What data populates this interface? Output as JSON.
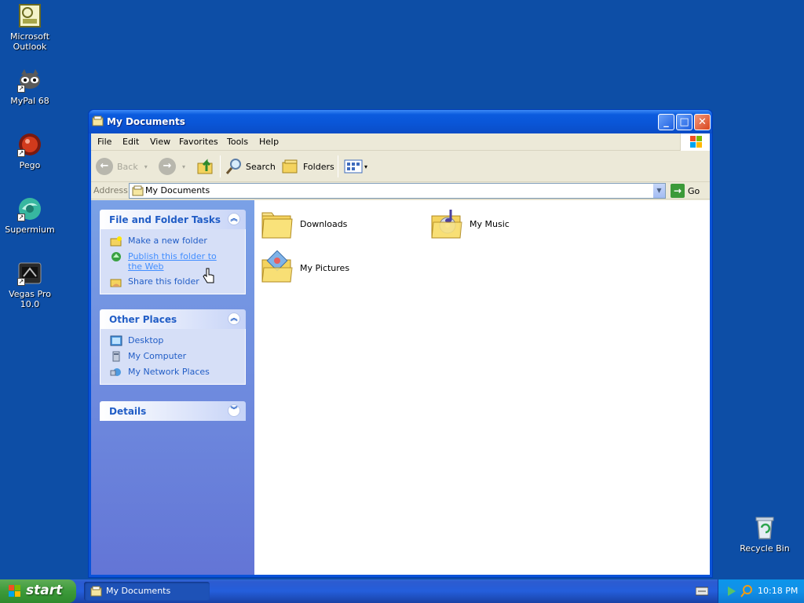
{
  "desktop": {
    "icons": [
      {
        "label": "Microsoft Outlook",
        "icon": "outlook-icon"
      },
      {
        "label": "MyPal 68",
        "icon": "raccoon-icon"
      },
      {
        "label": "Pego",
        "icon": "pego-icon"
      },
      {
        "label": "Supermium",
        "icon": "supermium-icon"
      },
      {
        "label": "Vegas Pro 10.0",
        "icon": "vegas-icon"
      },
      {
        "label": "Recycle Bin",
        "icon": "recycle-bin-icon"
      }
    ]
  },
  "window": {
    "title": "My Documents",
    "menu": [
      "File",
      "Edit",
      "View",
      "Favorites",
      "Tools",
      "Help"
    ],
    "toolbar": {
      "back": "Back",
      "search": "Search",
      "folders": "Folders"
    },
    "address": {
      "label": "Address",
      "value": "My Documents",
      "go": "Go"
    },
    "taskpane": {
      "file_tasks": {
        "title": "File and Folder Tasks",
        "items": [
          "Make a new folder",
          "Publish this folder to the Web",
          "Share this folder"
        ]
      },
      "other_places": {
        "title": "Other Places",
        "items": [
          "Desktop",
          "My Computer",
          "My Network Places"
        ]
      },
      "details": {
        "title": "Details"
      }
    },
    "items": [
      {
        "label": "Downloads",
        "icon": "folder-icon"
      },
      {
        "label": "My Music",
        "icon": "music-folder-icon"
      },
      {
        "label": "My Pictures",
        "icon": "pictures-folder-icon"
      }
    ]
  },
  "taskbar": {
    "start": "start",
    "task": "My Documents",
    "clock": "10:18 PM"
  },
  "colors": {
    "desktop": "#0d4ea6",
    "titlebar": "#0a55d6",
    "link": "#215dc6",
    "start": "#3c9a3a"
  }
}
